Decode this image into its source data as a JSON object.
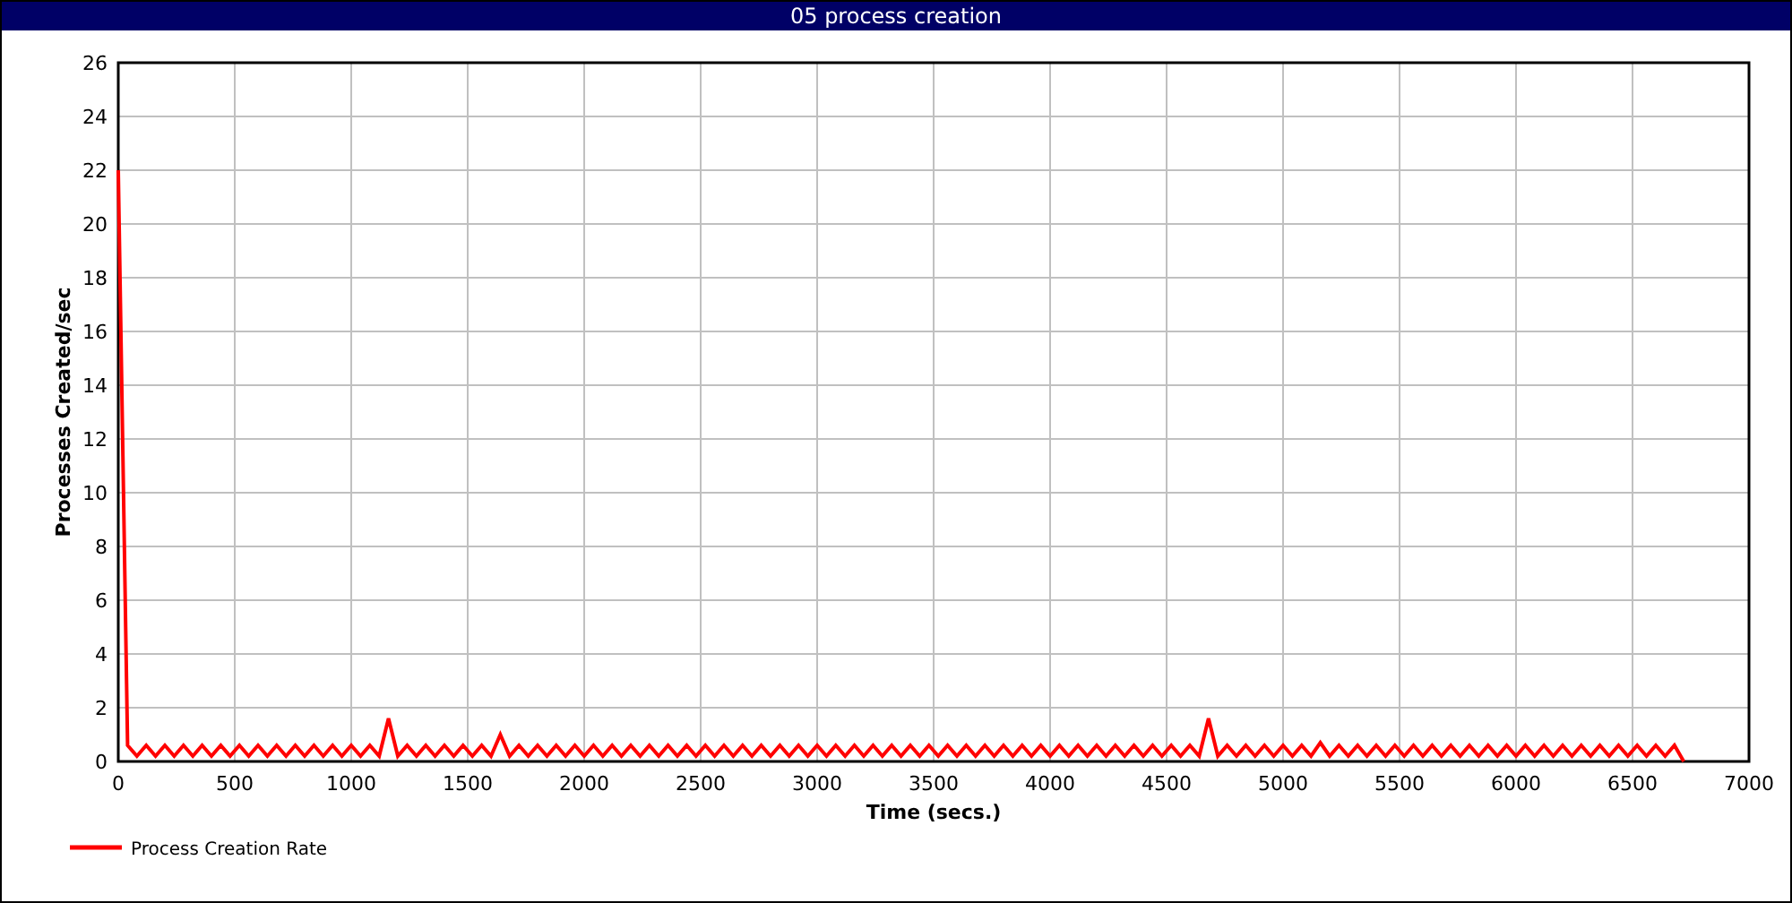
{
  "window": {
    "title": "05 process creation"
  },
  "chart": {
    "chart_data": {
      "type": "line",
      "grid": true,
      "xlabel": "Time (secs.)",
      "ylabel": "Processes Created/sec",
      "xlim": [
        0,
        7000
      ],
      "ylim": [
        0,
        26
      ],
      "xticks": [
        0,
        500,
        1000,
        1500,
        2000,
        2500,
        3000,
        3500,
        4000,
        4500,
        5000,
        5500,
        6000,
        6500,
        7000
      ],
      "yticks": [
        0,
        2,
        4,
        6,
        8,
        10,
        12,
        14,
        16,
        18,
        20,
        22,
        24,
        26
      ],
      "x": [
        0,
        40,
        80,
        120,
        160,
        200,
        240,
        280,
        320,
        360,
        400,
        440,
        480,
        520,
        560,
        600,
        640,
        680,
        720,
        760,
        800,
        840,
        880,
        920,
        960,
        1000,
        1040,
        1080,
        1120,
        1160,
        1200,
        1240,
        1280,
        1320,
        1360,
        1400,
        1440,
        1480,
        1520,
        1560,
        1600,
        1640,
        1680,
        1720,
        1760,
        1800,
        1840,
        1880,
        1920,
        1960,
        2000,
        2040,
        2080,
        2120,
        2160,
        2200,
        2240,
        2280,
        2320,
        2360,
        2400,
        2440,
        2480,
        2520,
        2560,
        2600,
        2640,
        2680,
        2720,
        2760,
        2800,
        2840,
        2880,
        2920,
        2960,
        3000,
        3040,
        3080,
        3120,
        3160,
        3200,
        3240,
        3280,
        3320,
        3360,
        3400,
        3440,
        3480,
        3520,
        3560,
        3600,
        3640,
        3680,
        3720,
        3760,
        3800,
        3840,
        3880,
        3920,
        3960,
        4000,
        4040,
        4080,
        4120,
        4160,
        4200,
        4240,
        4280,
        4320,
        4360,
        4400,
        4440,
        4480,
        4520,
        4560,
        4600,
        4640,
        4680,
        4720,
        4760,
        4800,
        4840,
        4880,
        4920,
        4960,
        5000,
        5040,
        5080,
        5120,
        5160,
        5200,
        5240,
        5280,
        5320,
        5360,
        5400,
        5440,
        5480,
        5520,
        5560,
        5600,
        5640,
        5680,
        5720,
        5760,
        5800,
        5840,
        5880,
        5920,
        5960,
        6000,
        6040,
        6080,
        6120,
        6160,
        6200,
        6240,
        6280,
        6320,
        6360,
        6400,
        6440,
        6480,
        6520,
        6560,
        6600,
        6640,
        6680,
        6720
      ],
      "series": [
        {
          "name": "Process Creation Rate",
          "color": "#ff0000",
          "values": [
            22,
            0.6,
            0.2,
            0.6,
            0.2,
            0.6,
            0.2,
            0.6,
            0.2,
            0.6,
            0.2,
            0.6,
            0.2,
            0.6,
            0.2,
            0.6,
            0.2,
            0.6,
            0.2,
            0.6,
            0.2,
            0.6,
            0.2,
            0.6,
            0.2,
            0.6,
            0.2,
            0.6,
            0.2,
            1.6,
            0.2,
            0.6,
            0.2,
            0.6,
            0.2,
            0.6,
            0.2,
            0.6,
            0.2,
            0.6,
            0.2,
            1.0,
            0.2,
            0.6,
            0.2,
            0.6,
            0.2,
            0.6,
            0.2,
            0.6,
            0.2,
            0.6,
            0.2,
            0.6,
            0.2,
            0.6,
            0.2,
            0.6,
            0.2,
            0.6,
            0.2,
            0.6,
            0.2,
            0.6,
            0.2,
            0.6,
            0.2,
            0.6,
            0.2,
            0.6,
            0.2,
            0.6,
            0.2,
            0.6,
            0.2,
            0.6,
            0.2,
            0.6,
            0.2,
            0.6,
            0.2,
            0.6,
            0.2,
            0.6,
            0.2,
            0.6,
            0.2,
            0.6,
            0.2,
            0.6,
            0.2,
            0.6,
            0.2,
            0.6,
            0.2,
            0.6,
            0.2,
            0.6,
            0.2,
            0.6,
            0.2,
            0.6,
            0.2,
            0.6,
            0.2,
            0.6,
            0.2,
            0.6,
            0.2,
            0.6,
            0.2,
            0.6,
            0.2,
            0.6,
            0.2,
            0.6,
            0.2,
            1.6,
            0.2,
            0.6,
            0.2,
            0.6,
            0.2,
            0.6,
            0.2,
            0.6,
            0.2,
            0.6,
            0.2,
            0.7,
            0.2,
            0.6,
            0.2,
            0.6,
            0.2,
            0.6,
            0.2,
            0.6,
            0.2,
            0.6,
            0.2,
            0.6,
            0.2,
            0.6,
            0.2,
            0.6,
            0.2,
            0.6,
            0.2,
            0.6,
            0.2,
            0.6,
            0.2,
            0.6,
            0.2,
            0.6,
            0.2,
            0.6,
            0.2,
            0.6,
            0.2,
            0.6,
            0.2,
            0.6,
            0.2,
            0.6,
            0.2,
            0.6,
            0
          ]
        }
      ]
    }
  }
}
